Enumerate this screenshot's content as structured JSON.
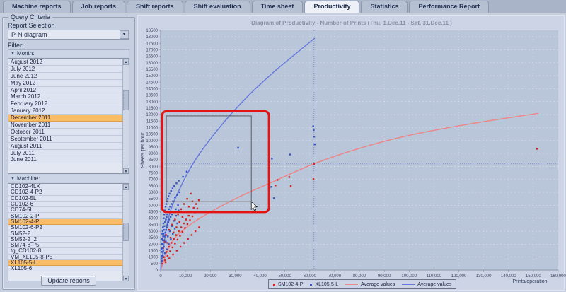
{
  "tabs": {
    "items": [
      {
        "label": "Machine reports",
        "active": false
      },
      {
        "label": "Job reports",
        "active": false
      },
      {
        "label": "Shift reports",
        "active": false
      },
      {
        "label": "Shift evaluation",
        "active": false
      },
      {
        "label": "Time sheet",
        "active": false
      },
      {
        "label": "Productivity",
        "active": true
      },
      {
        "label": "Statistics",
        "active": false
      },
      {
        "label": "Performance Report",
        "active": false
      }
    ]
  },
  "sidebar": {
    "group_title": "Query Criteria",
    "report_selection_label": "Report Selection",
    "report_selection_value": "P-N diagram",
    "filter_label": "Filter:",
    "month_header": "Month:",
    "months": [
      {
        "label": "August 2012",
        "selected": false
      },
      {
        "label": "July 2012",
        "selected": false
      },
      {
        "label": "June 2012",
        "selected": false
      },
      {
        "label": "May 2012",
        "selected": false
      },
      {
        "label": "April 2012",
        "selected": false
      },
      {
        "label": "March 2012",
        "selected": false
      },
      {
        "label": "February 2012",
        "selected": false
      },
      {
        "label": "January 2012",
        "selected": false
      },
      {
        "label": "December 2011",
        "selected": true
      },
      {
        "label": "November 2011",
        "selected": false
      },
      {
        "label": "October 2011",
        "selected": false
      },
      {
        "label": "September 2011",
        "selected": false
      },
      {
        "label": "August 2011",
        "selected": false
      },
      {
        "label": "July 2011",
        "selected": false
      },
      {
        "label": "June 2011",
        "selected": false
      }
    ],
    "machine_header": "Machine:",
    "machines": [
      {
        "label": "CD102-4LX",
        "selected": false
      },
      {
        "label": "CD102-4-P2",
        "selected": false
      },
      {
        "label": "CD102-5L",
        "selected": false
      },
      {
        "label": "CD102-6",
        "selected": false
      },
      {
        "label": "CD74-5L",
        "selected": false
      },
      {
        "label": "SM102-2-P",
        "selected": false
      },
      {
        "label": "SM102-4-P",
        "selected": true
      },
      {
        "label": "SM102-6-P2",
        "selected": false
      },
      {
        "label": "SM52-2",
        "selected": false
      },
      {
        "label": "SM52-2_2",
        "selected": false
      },
      {
        "label": "SM74-8-P5",
        "selected": false
      },
      {
        "label": "tg_CD102-8",
        "selected": false
      },
      {
        "label": "VM_XL105-8-P5",
        "selected": false
      },
      {
        "label": "XL105-5-L",
        "selected": true
      },
      {
        "label": "XL105-6",
        "selected": false
      }
    ],
    "update_button": "Update reports"
  },
  "chart_data": {
    "type": "scatter",
    "title": "Diagram of Productivity - Number of Prints   (Thu, 1.Dec.11  - Sat, 31.Dec.11 )",
    "xlabel": "Prints/operation",
    "ylabel": "Sheets per hour",
    "xlim": [
      0,
      160000
    ],
    "ylim": [
      0,
      18500
    ],
    "x_tick_step": 10000,
    "y_tick_step": 500,
    "grid": true,
    "legend_position": "bottom",
    "colors": {
      "red_series": "#d42020",
      "blue_series": "#3a56c4",
      "red_curve": "#ee8585",
      "blue_curve": "#6377dc",
      "crosshair": "#7c8cd6",
      "annotation_red": "#e51212",
      "selection_gray": "#5c5c5c",
      "selected_row_orange": "#f9bd68"
    },
    "crosshair": {
      "x": 61700,
      "y": 8200
    },
    "series": [
      {
        "name": "SM102-4-P",
        "color": "#d42020",
        "points": [
          [
            800,
            500
          ],
          [
            1300,
            1000
          ],
          [
            1800,
            750
          ],
          [
            2300,
            1400
          ],
          [
            2800,
            1100
          ],
          [
            3300,
            1800
          ],
          [
            3800,
            1450
          ],
          [
            4300,
            2100
          ],
          [
            4800,
            1750
          ],
          [
            5300,
            2400
          ],
          [
            5800,
            2050
          ],
          [
            6300,
            2700
          ],
          [
            6800,
            2350
          ],
          [
            7300,
            3000
          ],
          [
            7800,
            2650
          ],
          [
            8300,
            3300
          ],
          [
            8800,
            2950
          ],
          [
            9300,
            3600
          ],
          [
            9800,
            3250
          ],
          [
            10300,
            3900
          ],
          [
            10800,
            3550
          ],
          [
            11300,
            4200
          ],
          [
            11800,
            3850
          ],
          [
            12300,
            4500
          ],
          [
            12800,
            4150
          ],
          [
            13300,
            4800
          ],
          [
            13800,
            4450
          ],
          [
            14300,
            5100
          ],
          [
            14800,
            4750
          ],
          [
            15400,
            5400
          ],
          [
            1000,
            1700
          ],
          [
            1600,
            2200
          ],
          [
            2200,
            2700
          ],
          [
            2800,
            2100
          ],
          [
            3400,
            3100
          ],
          [
            4000,
            2500
          ],
          [
            4600,
            3500
          ],
          [
            5200,
            2900
          ],
          [
            5800,
            3900
          ],
          [
            6400,
            3300
          ],
          [
            7000,
            4300
          ],
          [
            7600,
            3700
          ],
          [
            8200,
            4700
          ],
          [
            8800,
            4100
          ],
          [
            9400,
            5100
          ],
          [
            10000,
            4500
          ],
          [
            10700,
            5500
          ],
          [
            11400,
            4900
          ],
          [
            12100,
            5900
          ],
          [
            12800,
            5300
          ],
          [
            2000,
            600
          ],
          [
            3500,
            900
          ],
          [
            5000,
            1200
          ],
          [
            6500,
            1500
          ],
          [
            8000,
            1800
          ],
          [
            9500,
            2100
          ],
          [
            11000,
            2400
          ],
          [
            12500,
            2700
          ],
          [
            14000,
            3000
          ],
          [
            15500,
            3300
          ],
          [
            46200,
            6530
          ],
          [
            47000,
            6960
          ],
          [
            51800,
            7180
          ],
          [
            52400,
            6480
          ],
          [
            61500,
            7020
          ],
          [
            61700,
            8200
          ],
          [
            151500,
            9360
          ]
        ]
      },
      {
        "name": "XL105-5-L",
        "color": "#3a56c4",
        "points": [
          [
            300,
            900
          ],
          [
            350,
            1600
          ],
          [
            420,
            1100
          ],
          [
            480,
            2000
          ],
          [
            520,
            1400
          ],
          [
            580,
            2400
          ],
          [
            640,
            1700
          ],
          [
            700,
            2800
          ],
          [
            760,
            2000
          ],
          [
            820,
            3000
          ],
          [
            880,
            2300
          ],
          [
            940,
            3300
          ],
          [
            1000,
            2600
          ],
          [
            1060,
            1500
          ],
          [
            1120,
            3600
          ],
          [
            1180,
            2800
          ],
          [
            1250,
            4000
          ],
          [
            1320,
            3100
          ],
          [
            1400,
            2300
          ],
          [
            1480,
            4300
          ],
          [
            1560,
            3400
          ],
          [
            1640,
            2600
          ],
          [
            1720,
            4600
          ],
          [
            1800,
            3700
          ],
          [
            1900,
            2900
          ],
          [
            2000,
            4900
          ],
          [
            2100,
            3900
          ],
          [
            2200,
            3100
          ],
          [
            2300,
            5100
          ],
          [
            2400,
            4100
          ],
          [
            2500,
            3300
          ],
          [
            2600,
            5300
          ],
          [
            2700,
            4300
          ],
          [
            2800,
            3500
          ],
          [
            2900,
            5500
          ],
          [
            3000,
            4500
          ],
          [
            3100,
            3700
          ],
          [
            3200,
            5700
          ],
          [
            3300,
            4700
          ],
          [
            3400,
            3900
          ],
          [
            3600,
            5900
          ],
          [
            3800,
            4900
          ],
          [
            4000,
            4100
          ],
          [
            4200,
            6100
          ],
          [
            4400,
            5100
          ],
          [
            4600,
            4300
          ],
          [
            4800,
            6300
          ],
          [
            5000,
            5300
          ],
          [
            5200,
            4500
          ],
          [
            5500,
            6500
          ],
          [
            5800,
            5600
          ],
          [
            6100,
            4700
          ],
          [
            6400,
            6700
          ],
          [
            6700,
            5800
          ],
          [
            7000,
            5000
          ],
          [
            7300,
            6900
          ],
          [
            7600,
            6000
          ],
          [
            500,
            700
          ],
          [
            900,
            1100
          ],
          [
            1300,
            1800
          ],
          [
            1700,
            1300
          ],
          [
            2100,
            2200
          ],
          [
            2500,
            1600
          ],
          [
            2900,
            2600
          ],
          [
            3300,
            2000
          ],
          [
            3700,
            3000
          ],
          [
            4100,
            2400
          ],
          [
            4500,
            3400
          ],
          [
            4900,
            2800
          ],
          [
            5300,
            3800
          ],
          [
            5700,
            3200
          ],
          [
            6200,
            4200
          ],
          [
            6700,
            3600
          ],
          [
            7200,
            4600
          ],
          [
            9000,
            7200
          ],
          [
            10500,
            7600
          ],
          [
            31200,
            9450
          ],
          [
            44500,
            6420
          ],
          [
            44800,
            8600
          ],
          [
            45600,
            5550
          ],
          [
            52100,
            8920
          ],
          [
            61400,
            11100
          ],
          [
            61600,
            10800
          ],
          [
            61800,
            10300
          ],
          [
            62000,
            9700
          ]
        ]
      }
    ],
    "average_curves": [
      {
        "name": "Average values",
        "series": "SM102-4-P",
        "color": "#ee8585",
        "points": [
          [
            0,
            0
          ],
          [
            5000,
            2300
          ],
          [
            15000,
            3900
          ],
          [
            30000,
            5500
          ],
          [
            45000,
            6800
          ],
          [
            61700,
            8200
          ],
          [
            80000,
            9400
          ],
          [
            100000,
            10400
          ],
          [
            125000,
            11300
          ],
          [
            152000,
            12100
          ]
        ]
      },
      {
        "name": "Average values",
        "series": "XL105-5-L",
        "color": "#6377dc",
        "points": [
          [
            0,
            0
          ],
          [
            3000,
            3900
          ],
          [
            8000,
            6400
          ],
          [
            15000,
            8800
          ],
          [
            25000,
            11300
          ],
          [
            35000,
            13400
          ],
          [
            45000,
            15200
          ],
          [
            55000,
            16800
          ],
          [
            62000,
            17900
          ]
        ]
      }
    ],
    "selection_rect": {
      "x1": 2300,
      "y1": 5280,
      "x2": 36500,
      "y2": 11900
    },
    "annotation_rect": {
      "x1": 600,
      "y1": 4480,
      "x2": 43600,
      "y2": 12260
    },
    "legend": [
      {
        "type": "point",
        "color": "#d42020",
        "label": "SM102-4-P"
      },
      {
        "type": "point",
        "color": "#3a56c4",
        "label": "XL105-5-L"
      },
      {
        "type": "line",
        "color": "#ee8585",
        "label": "Average values"
      },
      {
        "type": "line",
        "color": "#6377dc",
        "label": "Average values"
      }
    ]
  }
}
